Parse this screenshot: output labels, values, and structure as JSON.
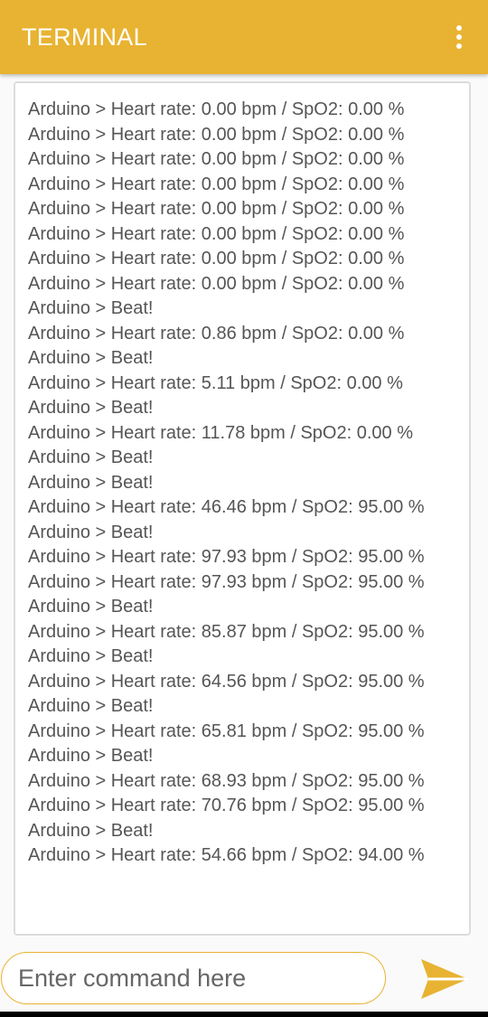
{
  "appbar": {
    "title": "TERMINAL",
    "menu_icon": "more-vertical-icon"
  },
  "colors": {
    "accent": "#e8b332",
    "text": "#555555"
  },
  "terminal": {
    "lines": [
      "Arduino > Heart rate: 0.00 bpm / SpO2: 0.00 %",
      "Arduino > Heart rate: 0.00 bpm / SpO2: 0.00 %",
      "Arduino > Heart rate: 0.00 bpm / SpO2: 0.00 %",
      "Arduino > Heart rate: 0.00 bpm / SpO2: 0.00 %",
      "Arduino > Heart rate: 0.00 bpm / SpO2: 0.00 %",
      "Arduino > Heart rate: 0.00 bpm / SpO2: 0.00 %",
      "Arduino > Heart rate: 0.00 bpm / SpO2: 0.00 %",
      "Arduino > Heart rate: 0.00 bpm / SpO2: 0.00 %",
      "Arduino > Beat!",
      "Arduino > Heart rate: 0.86 bpm / SpO2: 0.00 %",
      "Arduino > Beat!",
      "Arduino > Heart rate: 5.11 bpm / SpO2: 0.00 %",
      "Arduino > Beat!",
      "Arduino > Heart rate: 11.78 bpm / SpO2: 0.00 %",
      "Arduino > Beat!",
      "Arduino > Beat!",
      "Arduino > Heart rate: 46.46 bpm / SpO2: 95.00 %",
      "Arduino > Beat!",
      "Arduino > Heart rate: 97.93 bpm / SpO2: 95.00 %",
      "Arduino > Heart rate: 97.93 bpm / SpO2: 95.00 %",
      "Arduino > Beat!",
      "Arduino > Heart rate: 85.87 bpm / SpO2: 95.00 %",
      "Arduino > Beat!",
      "Arduino > Heart rate: 64.56 bpm / SpO2: 95.00 %",
      "Arduino > Beat!",
      "Arduino > Heart rate: 65.81 bpm / SpO2: 95.00 %",
      "Arduino > Beat!",
      "Arduino > Heart rate: 68.93 bpm / SpO2: 95.00 %",
      "Arduino > Heart rate: 70.76 bpm / SpO2: 95.00 %",
      "Arduino > Beat!",
      "Arduino > Heart rate: 54.66 bpm / SpO2: 94.00 %"
    ]
  },
  "command": {
    "placeholder": "Enter command here",
    "value": "",
    "send_icon": "send-icon"
  }
}
